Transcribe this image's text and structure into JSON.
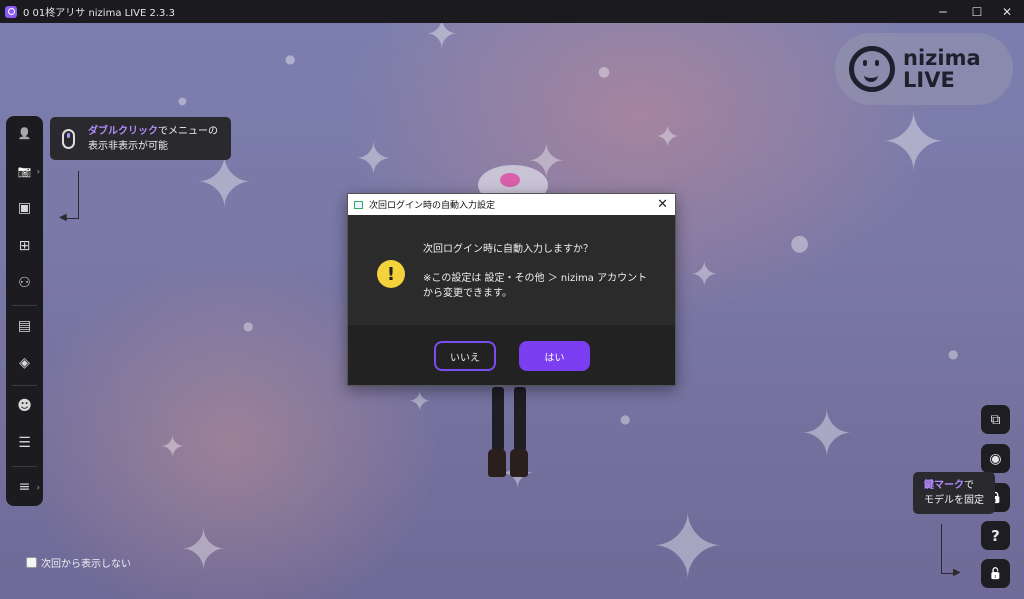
{
  "window": {
    "title": "0 01柊アリサ nizima LIVE 2.3.3",
    "controls": {
      "minimize": "─",
      "maximize": "☐",
      "close": "✕"
    }
  },
  "logo": {
    "line1": "nizima",
    "line2": "LIVE"
  },
  "sidebar": {
    "items": [
      {
        "name": "person-icon",
        "glyph": "👤"
      },
      {
        "name": "camera-off-icon",
        "glyph": "📷"
      },
      {
        "name": "image-icon",
        "glyph": "▣"
      },
      {
        "name": "add-item-icon",
        "glyph": "⊞"
      },
      {
        "name": "collab-icon",
        "glyph": "⚇"
      },
      {
        "name": "archive-icon",
        "glyph": "▤"
      },
      {
        "name": "layers-icon",
        "glyph": "◈"
      },
      {
        "name": "face-icon",
        "glyph": "☻"
      },
      {
        "name": "sliders-icon",
        "glyph": "☰"
      },
      {
        "name": "menu-icon",
        "glyph": "≡"
      }
    ]
  },
  "tip_menu": {
    "highlight": "ダブルクリック",
    "line1_rest": "でメニューの",
    "line2": "表示非表示が可能"
  },
  "tip_lock": {
    "highlight": "鍵マーク",
    "line1_rest": "で",
    "line2": "モデルを固定"
  },
  "dialog": {
    "title": "次回ログイン時の自動入力設定",
    "close": "✕",
    "warning_glyph": "!",
    "question": "次回ログイン時に自動入力しますか？",
    "note_line1": "※この設定は 設定・その他 ＞ nizima アカウント",
    "note_line2": "から変更できます。",
    "no_label": "いいえ",
    "yes_label": "はい"
  },
  "right_controls": {
    "items": [
      {
        "name": "windows-icon",
        "glyph": "⧉"
      },
      {
        "name": "camera-icon",
        "glyph": "◉"
      },
      {
        "name": "lock-icon",
        "glyph": "🔒"
      },
      {
        "name": "help-icon",
        "glyph": "?"
      },
      {
        "name": "unlock-icon",
        "glyph": "🔓"
      }
    ]
  },
  "dont_show": {
    "label": "次回から表示しない"
  },
  "colors": {
    "accent": "#7b3ef0",
    "warning": "#f3d23b",
    "panel": "#1b1b20"
  }
}
